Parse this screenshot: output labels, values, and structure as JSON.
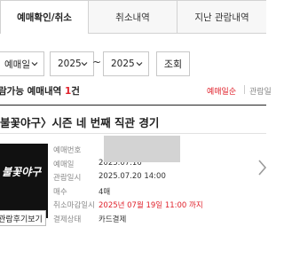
{
  "tabs": [
    {
      "label": "예매확인/취소"
    },
    {
      "label": "취소내역"
    },
    {
      "label": "지난 관람내역"
    }
  ],
  "filters": {
    "type_value": "예매일",
    "from_year": "2025",
    "separator": "~",
    "to_year": "2025",
    "search_label": "조회"
  },
  "summary": {
    "label_prefix": "람가능 예매내역 ",
    "count": "1",
    "label_suffix": "건"
  },
  "sort": {
    "option1": "예매일순",
    "option2": "관람일"
  },
  "booking": {
    "title": "불꽃야구〉시즌 네 번째 직관 경기",
    "thumbnail_text": "불꽃야구",
    "review_button": "관람후기보기",
    "rows": [
      {
        "label": "예매번호",
        "value": ""
      },
      {
        "label": "예매일",
        "value": "2025.07.16"
      },
      {
        "label": "관람일시",
        "value": "2025.07.20 14:00"
      },
      {
        "label": "매수",
        "value": "4매"
      },
      {
        "label": "취소마감일시",
        "value": "2025년 07월 19일 11:00 까지"
      },
      {
        "label": "결제상태",
        "value": "카드결제"
      }
    ]
  },
  "colors": {
    "accent_red": "#e0212b",
    "border": "#d2d2d2",
    "text": "#222222"
  }
}
